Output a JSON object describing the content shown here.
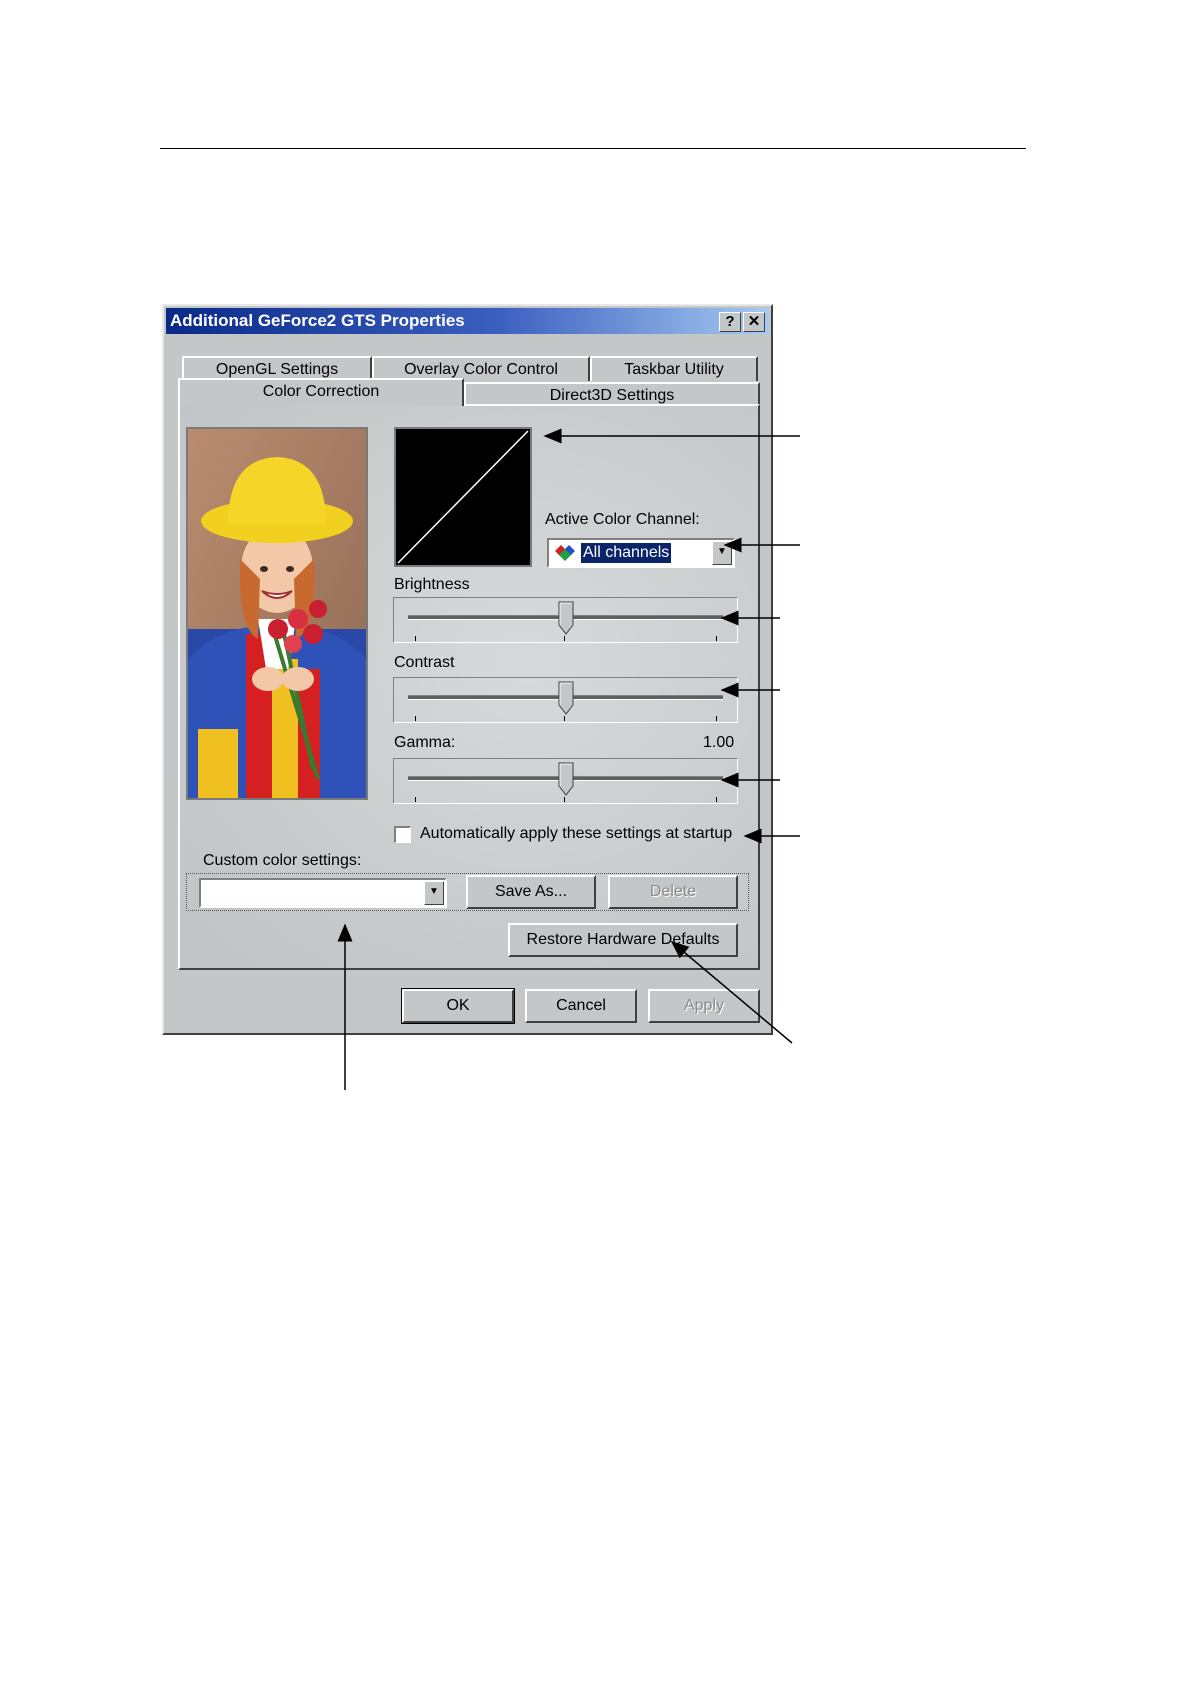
{
  "window": {
    "title": "Additional GeForce2 GTS Properties",
    "help_button": "?",
    "close_button": "✕",
    "title_color": "#0a2a88"
  },
  "tabs": {
    "row_back": [
      "OpenGL Settings",
      "Overlay Color Control",
      "Taskbar Utility"
    ],
    "row_front": [
      "Color Correction",
      "Direct3D Settings"
    ],
    "active": "Color Correction"
  },
  "color_correction": {
    "active_channel_label": "Active Color Channel:",
    "active_channel_value": "All channels",
    "brightness": {
      "label": "Brightness",
      "level": 0.5
    },
    "contrast": {
      "label": "Contrast",
      "level": 0.5
    },
    "gamma": {
      "label": "Gamma:",
      "value": "1.00",
      "level": 0.5
    },
    "auto_apply_label": "Automatically apply these settings at startup",
    "auto_apply_checked": false,
    "custom_settings_label": "Custom color settings:",
    "custom_settings_value": "",
    "save_as_label": "Save As...",
    "delete_label": "Delete",
    "restore_label": "Restore Hardware Defaults"
  },
  "footer": {
    "ok_label": "OK",
    "cancel_label": "Cancel",
    "apply_label": "Apply"
  },
  "icons": [
    "help-icon",
    "close-icon",
    "color-channel-icon",
    "dropdown-arrow-icon",
    "slider-thumb-icon"
  ]
}
